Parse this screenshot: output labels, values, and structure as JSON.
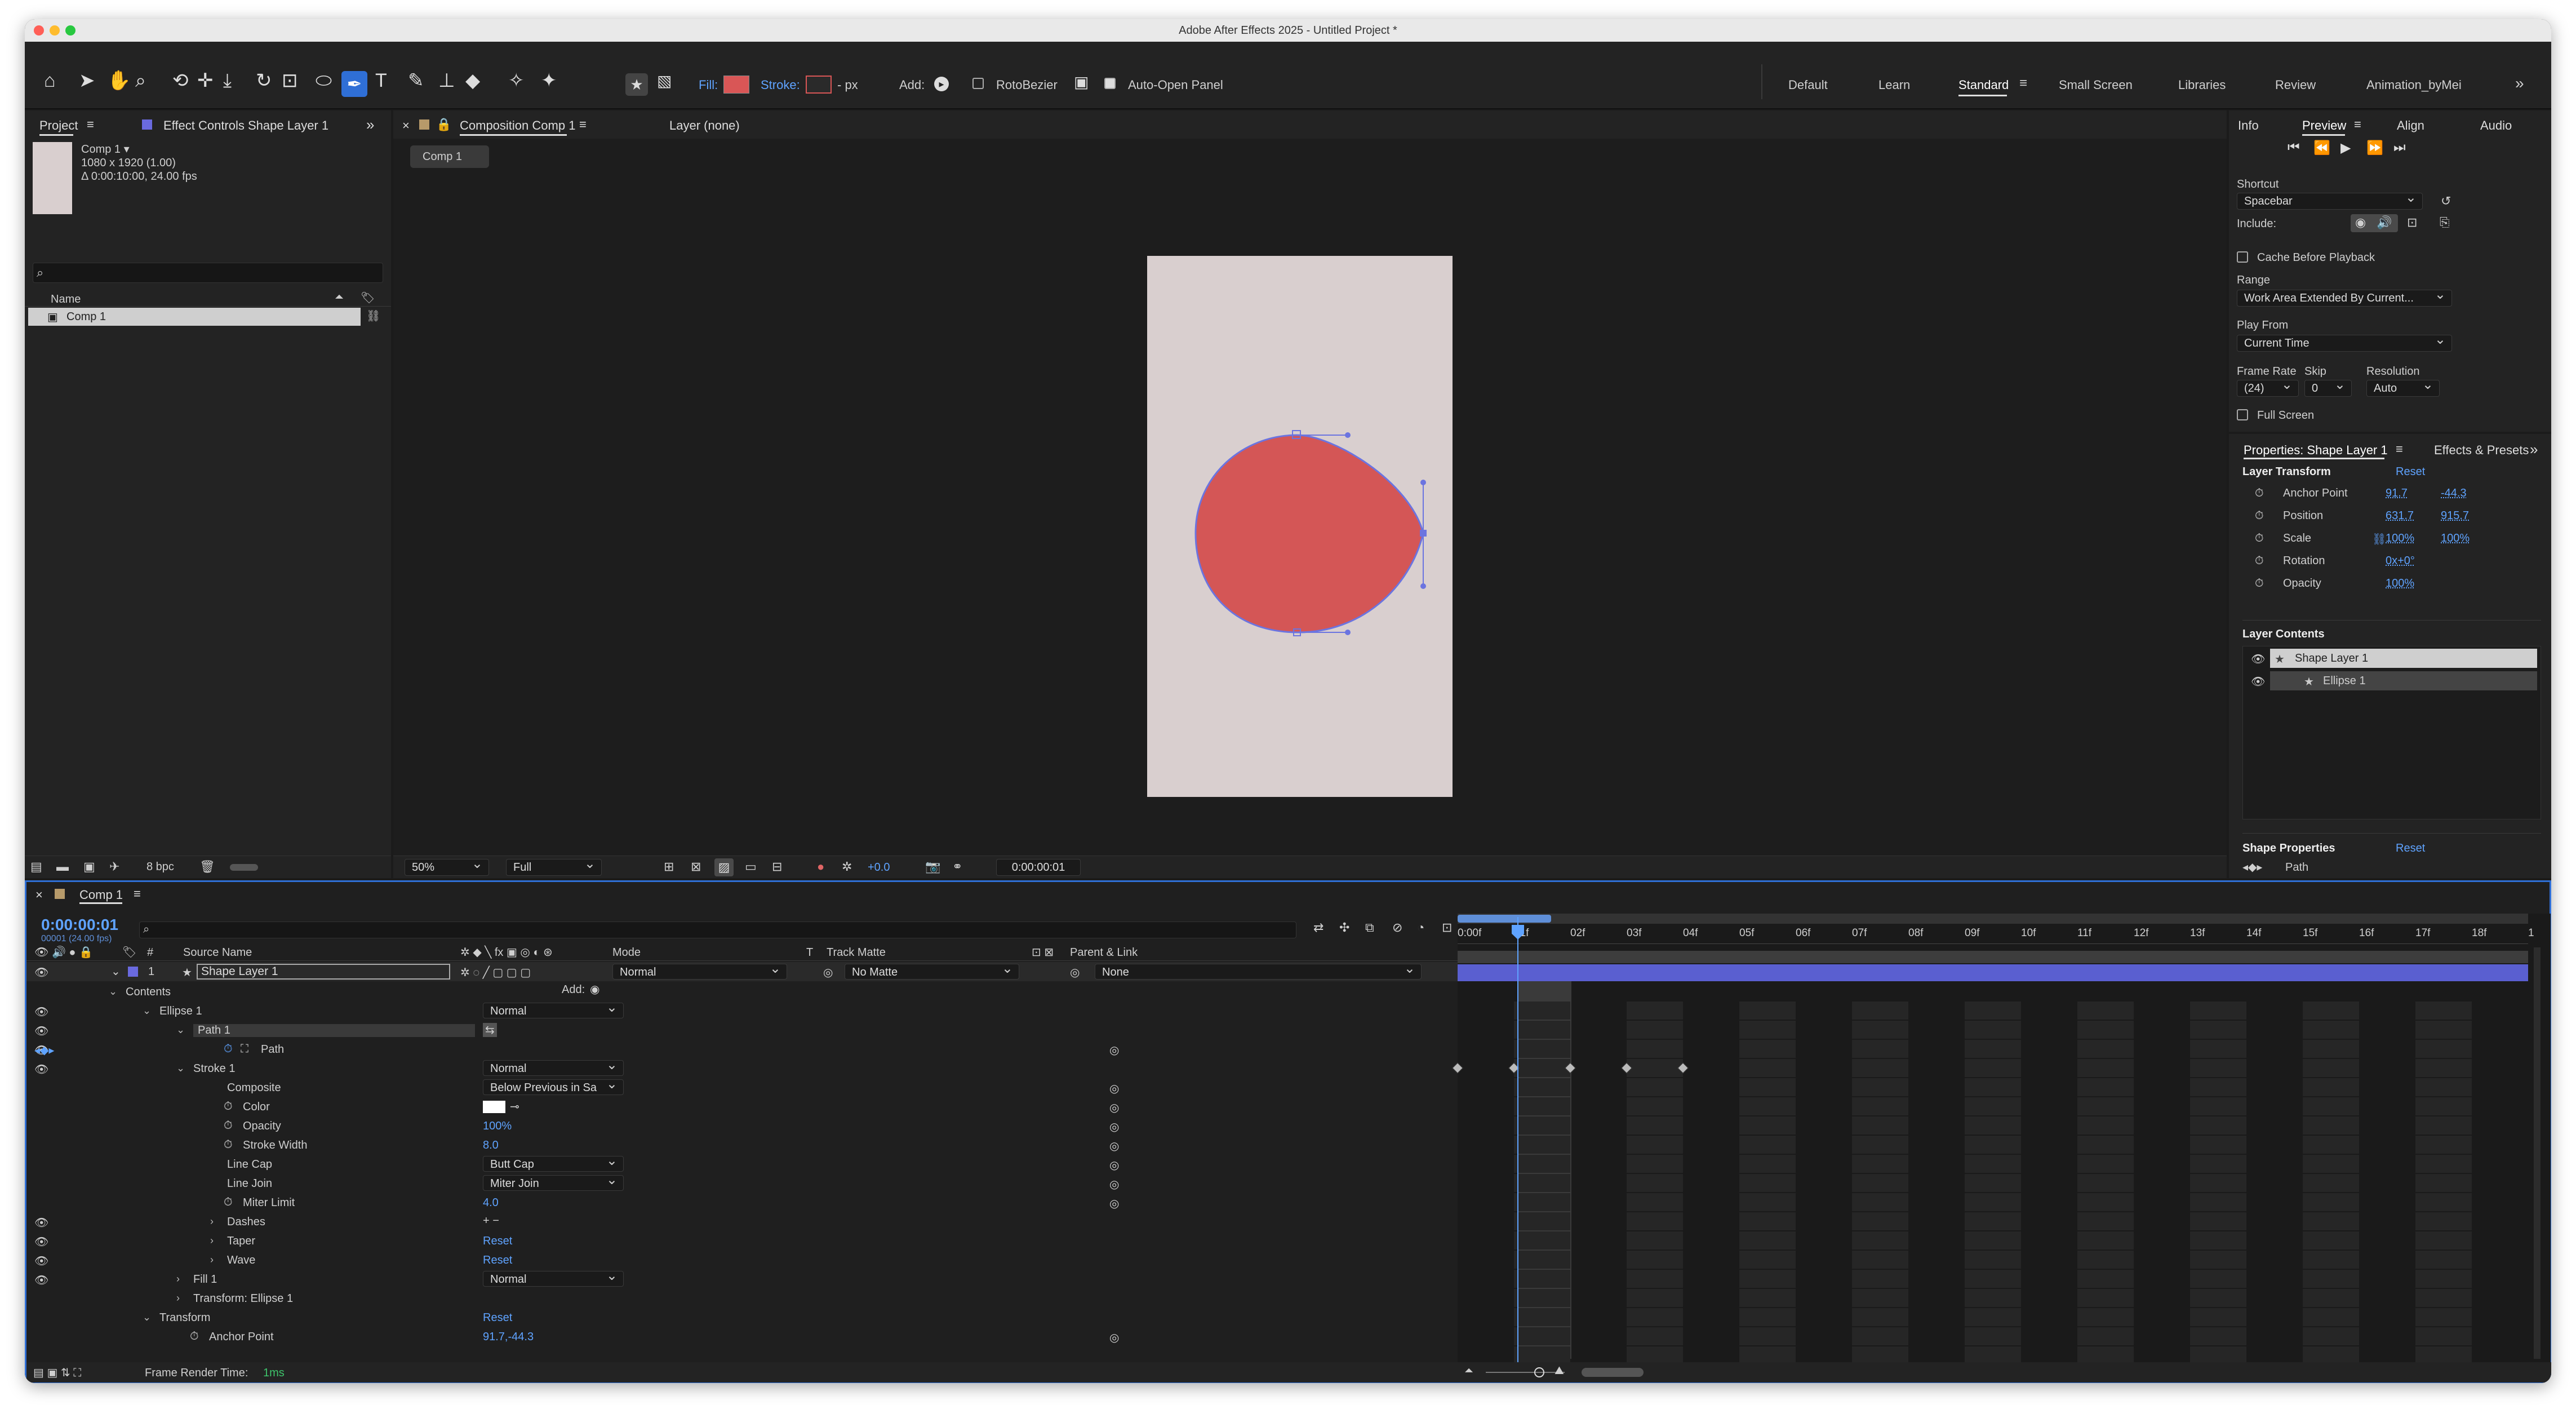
{
  "window": {
    "title": "Adobe After Effects 2025 - Untitled Project *"
  },
  "toolbar": {
    "fill_label": "Fill:",
    "stroke_label": "Stroke:",
    "stroke_px": "- px",
    "add_label": "Add:",
    "rotobezier_label": "RotoBezier",
    "auto_open_label": "Auto-Open Panel",
    "fill_color": "#d95656",
    "workspaces": [
      "Default",
      "Learn",
      "Standard",
      "Small Screen",
      "Libraries",
      "Review",
      "Animation_byMei"
    ],
    "active_workspace": "Standard"
  },
  "project": {
    "tab_project": "Project",
    "tab_effect_controls": "Effect Controls Shape Layer 1",
    "comp_name": "Comp 1 ▾",
    "comp_size": "1080 x 1920 (1.00)",
    "comp_duration": "Δ 0:00:10:00, 24.00 fps",
    "search_placeholder": "",
    "col_name": "Name",
    "items": [
      "Comp 1"
    ],
    "bpc": "8 bpc"
  },
  "composition": {
    "tab_comp": "Composition Comp 1",
    "tab_layer": "Layer (none)",
    "breadcrumb": "Comp 1",
    "zoom": "50%",
    "resolution": "Full",
    "exposure": "+0.0",
    "timecode": "0:00:00:01",
    "canvas_color": "#d9cfcf",
    "shape_color": "#d45656"
  },
  "preview": {
    "tab_info": "Info",
    "tab_preview": "Preview",
    "tab_align": "Align",
    "tab_audio": "Audio",
    "shortcut_label": "Shortcut",
    "shortcut_value": "Spacebar",
    "include_label": "Include:",
    "cache_label": "Cache Before Playback",
    "range_label": "Range",
    "range_value": "Work Area Extended By Current...",
    "play_from_label": "Play From",
    "play_from_value": "Current Time",
    "frame_rate_label": "Frame Rate",
    "skip_label": "Skip",
    "resolution_label": "Resolution",
    "frame_rate_value": "(24)",
    "skip_value": "0",
    "resolution_value": "Auto",
    "full_screen_label": "Full Screen"
  },
  "properties": {
    "tab_properties": "Properties: Shape Layer 1",
    "tab_effects": "Effects & Presets",
    "layer_transform": "Layer Transform",
    "reset": "Reset",
    "rows": [
      {
        "label": "Anchor Point",
        "v1": "91.7",
        "v2": "-44.3"
      },
      {
        "label": "Position",
        "v1": "631.7",
        "v2": "915.7"
      },
      {
        "label": "Scale",
        "v1": "100%",
        "v2": "100%"
      },
      {
        "label": "Rotation",
        "v1": "0x+0°",
        "v2": ""
      },
      {
        "label": "Opacity",
        "v1": "100%",
        "v2": ""
      }
    ],
    "layer_contents": "Layer Contents",
    "contents": [
      "Shape Layer 1",
      "Ellipse 1"
    ],
    "shape_properties": "Shape Properties",
    "shape_reset": "Reset",
    "path_label": "Path"
  },
  "timeline": {
    "tab": "Comp 1",
    "timecode": "0:00:00:01",
    "timecode_sub": "00001 (24.00 fps)",
    "col_source": "Source Name",
    "col_mode": "Mode",
    "col_t": "T",
    "col_trackmatte": "Track Matte",
    "col_parent": "Parent & Link",
    "layer_index": "1",
    "layer_name": "Shape Layer 1",
    "layer_mode": "Normal",
    "layer_matte": "No Matte",
    "layer_parent": "None",
    "add_label": "Add:",
    "ruler": [
      "0:00f",
      "01f",
      "02f",
      "03f",
      "04f",
      "05f",
      "06f",
      "07f",
      "08f",
      "09f",
      "10f",
      "11f",
      "12f",
      "13f",
      "14f",
      "15f",
      "16f",
      "17f",
      "18f",
      "1"
    ],
    "rows": [
      {
        "indent": 0,
        "label": "Contents",
        "value": ""
      },
      {
        "indent": 1,
        "label": "Ellipse 1",
        "value": "Normal"
      },
      {
        "indent": 2,
        "label": "Path 1",
        "value": ""
      },
      {
        "indent": 3,
        "label": "Path",
        "value": ""
      },
      {
        "indent": 2,
        "label": "Stroke 1",
        "value": "Normal"
      },
      {
        "indent": 3,
        "label": "Composite",
        "value": "Below Previous in Sa"
      },
      {
        "indent": 3,
        "label": "Color",
        "value": ""
      },
      {
        "indent": 3,
        "label": "Opacity",
        "value": "100%"
      },
      {
        "indent": 3,
        "label": "Stroke Width",
        "value": "8.0"
      },
      {
        "indent": 3,
        "label": "Line Cap",
        "value": "Butt Cap"
      },
      {
        "indent": 3,
        "label": "Line Join",
        "value": "Miter Join"
      },
      {
        "indent": 3,
        "label": "Miter Limit",
        "value": "4.0"
      },
      {
        "indent": 3,
        "label": "Dashes",
        "value": ""
      },
      {
        "indent": 3,
        "label": "Taper",
        "value": "Reset"
      },
      {
        "indent": 3,
        "label": "Wave",
        "value": "Reset"
      },
      {
        "indent": 2,
        "label": "Fill 1",
        "value": "Normal"
      },
      {
        "indent": 2,
        "label": "Transform: Ellipse 1",
        "value": ""
      },
      {
        "indent": 1,
        "label": "Transform",
        "value": "Reset"
      },
      {
        "indent": 2,
        "label": "Anchor Point",
        "value": "91.7,-44.3"
      }
    ],
    "frame_render_label": "Frame Render Time:",
    "frame_render_value": "1ms"
  }
}
